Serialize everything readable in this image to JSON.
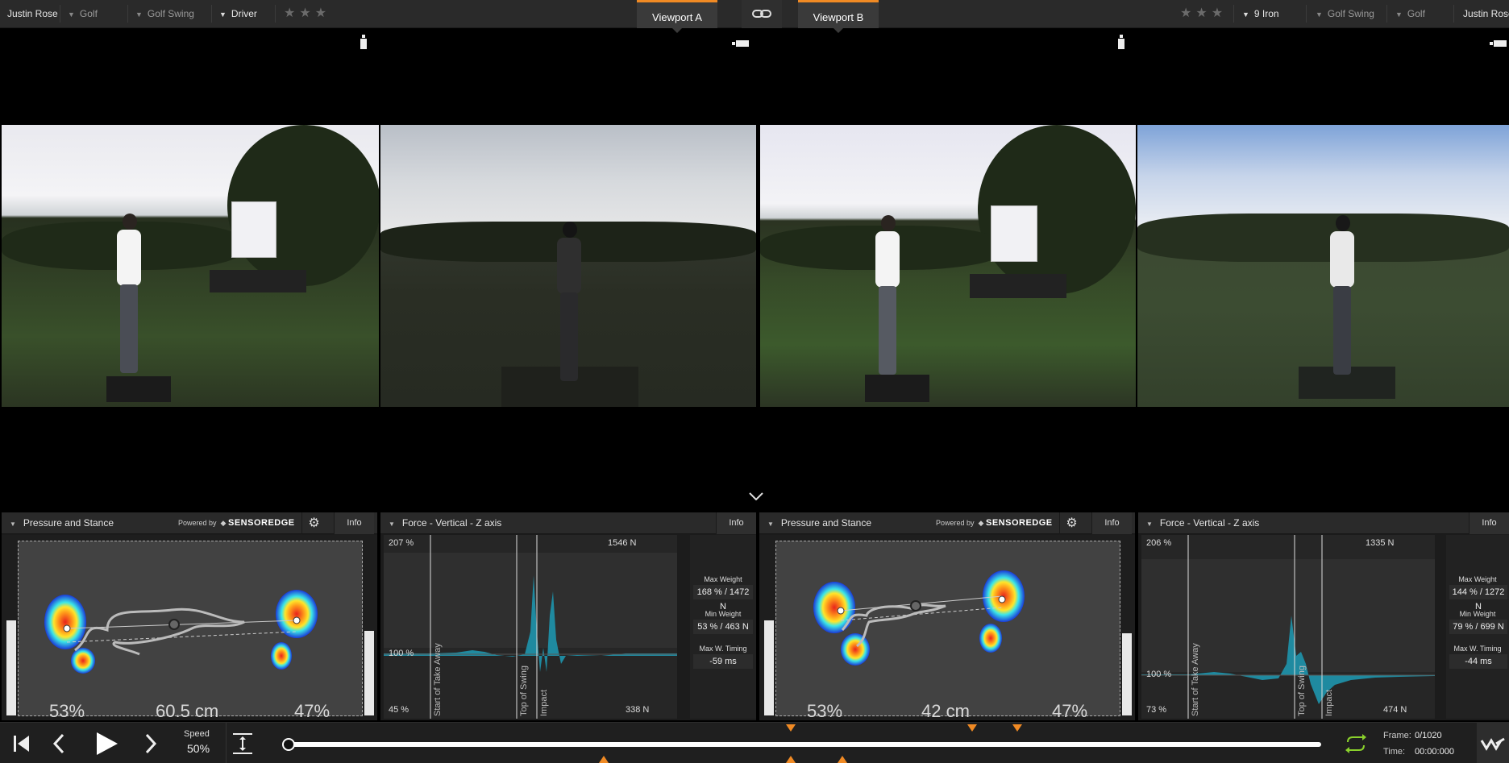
{
  "topbar": {
    "left": {
      "athlete": "Justin Rose",
      "sport": "Golf",
      "activity": "Golf Swing",
      "club": "Driver",
      "rating_stars": "★★★"
    },
    "viewport_a_label": "Viewport A",
    "link_icon": "link-icon",
    "viewport_b_label": "Viewport B",
    "right": {
      "rating_stars": "★★★",
      "club": "9 Iron",
      "activity": "Golf Swing",
      "sport": "Golf",
      "athlete": "Justin Rose"
    }
  },
  "panels": {
    "a_pressure": {
      "title": "Pressure and Stance",
      "powered_by": "Powered by",
      "brand": "SENSOREDGE",
      "info": "Info",
      "left_pct": "53%",
      "stance_width": "60.5 cm",
      "right_pct": "47%"
    },
    "a_force": {
      "title": "Force - Vertical - Z axis",
      "info": "Info",
      "top_pct": "207 %",
      "top_n": "1546 N",
      "mid_pct": "100 %",
      "bot_pct": "45 %",
      "bot_n": "338 N",
      "markers": [
        "Start of Take Away",
        "Top of Swing",
        "Impact"
      ],
      "max_weight_label": "Max Weight",
      "max_weight": "168 % / 1472 N",
      "min_weight_label": "Min Weight",
      "min_weight": "53 % / 463 N",
      "max_timing_label": "Max W. Timing",
      "max_timing": "-59 ms"
    },
    "b_pressure": {
      "title": "Pressure and Stance",
      "powered_by": "Powered by",
      "brand": "SENSOREDGE",
      "info": "Info",
      "left_pct": "53%",
      "stance_width": "42 cm",
      "right_pct": "47%"
    },
    "b_force": {
      "title": "Force - Vertical - Z axis",
      "info": "Info",
      "top_pct": "206 %",
      "top_n": "1335 N",
      "mid_pct": "100 %",
      "bot_pct": "73 %",
      "bot_n": "474 N",
      "markers": [
        "Start of Take Away",
        "Top of Swing",
        "Impact"
      ],
      "max_weight_label": "Max Weight",
      "max_weight": "144 % / 1272 N",
      "min_weight_label": "Min Weight",
      "min_weight": "79 % / 699 N",
      "max_timing_label": "Max W. Timing",
      "max_timing": "-44 ms"
    }
  },
  "controls": {
    "speed_label": "Speed",
    "speed_value": "50%",
    "frame_label": "Frame:",
    "frame_value": "0/1020",
    "time_label": "Time:",
    "time_value": "00:00:000",
    "playhead_fraction": 0
  },
  "colors": {
    "accent": "#f08a24",
    "force_fill": "#1f8aa0",
    "loop_icon": "#8ad12c"
  }
}
